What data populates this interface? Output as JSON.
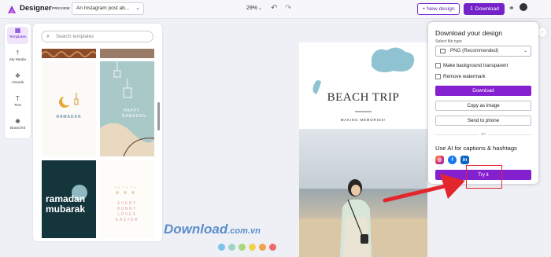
{
  "topbar": {
    "app_title": "Designer",
    "preview_tag": "PREVIEW",
    "doc_title": "An Instagram post ab...",
    "zoom": "29%",
    "new_design_label": "+ New design",
    "download_label": "Download",
    "logo_icon": "designer-logo-icon",
    "undo_icon": "undo-icon",
    "redo_icon": "redo-icon"
  },
  "rail": {
    "items": [
      {
        "label": "Templates",
        "icon": "templates-icon",
        "active": true
      },
      {
        "label": "My Media",
        "icon": "upload-icon"
      },
      {
        "label": "Visuals",
        "icon": "shapes-icon"
      },
      {
        "label": "Text",
        "icon": "text-icon"
      },
      {
        "label": "Brand kit",
        "icon": "palette-icon"
      }
    ]
  },
  "templates": {
    "search_placeholder": "Search templates",
    "cards": [
      {
        "lines": [
          "RAMADAN"
        ]
      },
      {
        "lines": [
          "HAPPY",
          "RAMADAN"
        ]
      },
      {
        "lines": [
          "ramadan",
          "mubarak"
        ]
      },
      {
        "lines": [
          "EVERY",
          "BUNNY",
          "LOVES",
          "EASTER"
        ]
      }
    ]
  },
  "canvas": {
    "title": "BEACH TRIP",
    "subtitle": "MAKING MEMORIES!"
  },
  "download_panel": {
    "title": "Download your design",
    "file_type_label": "Select file type",
    "file_type_value": "PNG (Recommended)",
    "option_transparent": "Make background transparent",
    "option_watermark": "Remove watermark",
    "download_button": "Download",
    "copy_button": "Copy as image",
    "send_button": "Send to phone",
    "divider_text": "OR",
    "ai_title": "Use AI for captions & hashtags",
    "social_icons": [
      "instagram-icon",
      "facebook-icon",
      "linkedin-icon"
    ],
    "try_button": "Try it"
  },
  "watermark": {
    "brand": "Download",
    "suffix": ".com.vn",
    "dot_colors": [
      "#7fc2e8",
      "#9fd3c7",
      "#a7d67e",
      "#f2d14f",
      "#f5a04a",
      "#ee6a6a"
    ]
  },
  "colors": {
    "accent": "#8420cf",
    "arrow": "#e3262e",
    "canvas_blob": "#8fc3d1"
  }
}
